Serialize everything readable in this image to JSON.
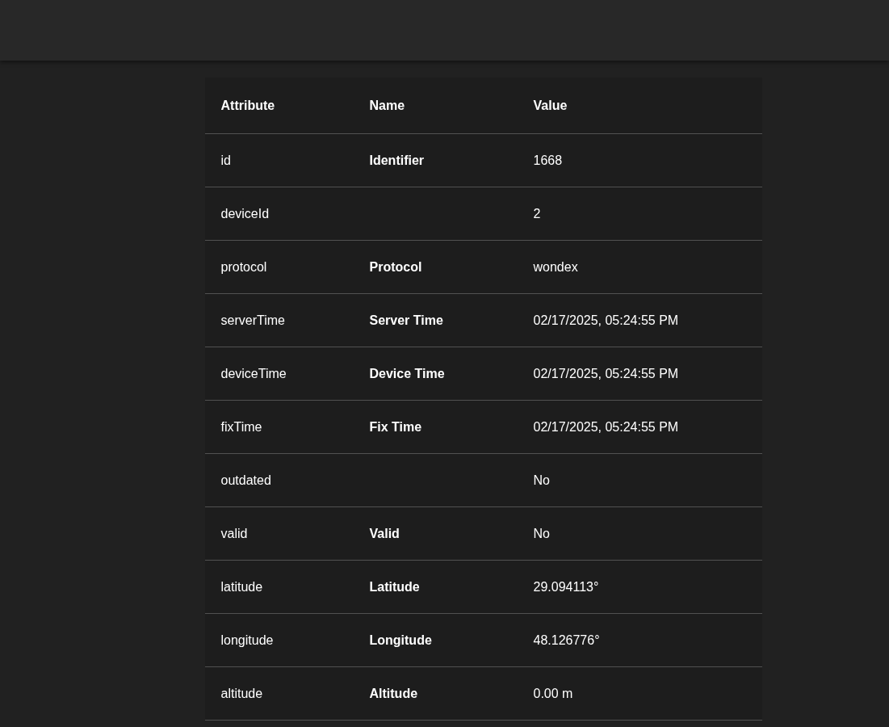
{
  "table": {
    "columns": [
      "Attribute",
      "Name",
      "Value"
    ],
    "rows": [
      {
        "attribute": "id",
        "name": "Identifier",
        "value": "1668"
      },
      {
        "attribute": "deviceId",
        "value": "2"
      },
      {
        "attribute": "protocol",
        "name": "Protocol",
        "value": "wondex"
      },
      {
        "attribute": "serverTime",
        "name": "Server Time",
        "value": "02/17/2025, 05:24:55 PM"
      },
      {
        "attribute": "deviceTime",
        "name": "Device Time",
        "value": "02/17/2025, 05:24:55 PM"
      },
      {
        "attribute": "fixTime",
        "name": "Fix Time",
        "value": "02/17/2025, 05:24:55 PM"
      },
      {
        "attribute": "outdated",
        "value": "No"
      },
      {
        "attribute": "valid",
        "name": "Valid",
        "value": "No"
      },
      {
        "attribute": "latitude",
        "name": "Latitude",
        "value": "29.094113°"
      },
      {
        "attribute": "longitude",
        "name": "Longitude",
        "value": "48.126776°"
      },
      {
        "attribute": "altitude",
        "name": "Altitude",
        "value": "0.00 m"
      }
    ]
  }
}
